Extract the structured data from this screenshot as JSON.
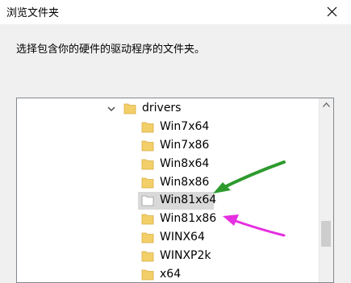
{
  "window": {
    "title": "浏览文件夹",
    "close_icon": "close-icon"
  },
  "instruction": "选择包含你的硬件的驱动程序的文件夹。",
  "tree": {
    "parent": {
      "label": "drivers",
      "expanded": true
    },
    "items": [
      {
        "label": "Win7x64",
        "selected": false
      },
      {
        "label": "Win7x86",
        "selected": false
      },
      {
        "label": "Win8x64",
        "selected": false
      },
      {
        "label": "Win8x86",
        "selected": false
      },
      {
        "label": "Win81x64",
        "selected": true
      },
      {
        "label": "Win81x86",
        "selected": false
      },
      {
        "label": "WINX64",
        "selected": false
      },
      {
        "label": "WINXP2k",
        "selected": false
      },
      {
        "label": "x64",
        "selected": false
      }
    ]
  },
  "colors": {
    "folder": "#f3cf6a",
    "selection": "#d9d9d9",
    "green_arrow": "#2e9a2e",
    "magenta_arrow": "#e52fe0"
  }
}
